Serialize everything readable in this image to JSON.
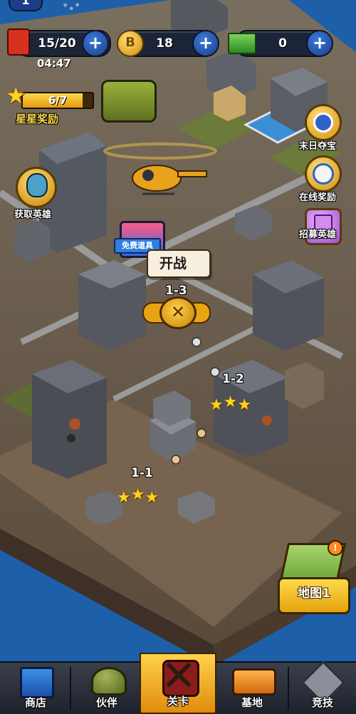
{
  "top": {
    "level": "1",
    "energy": "15/20",
    "energy_timer": "04:47",
    "coins": "18",
    "cash": "0",
    "plus_symbol": "+",
    "coin_symbol": "B"
  },
  "stars": {
    "progress_text": "6/7",
    "progress_fraction": 0.857,
    "reward_label": "星星奖励"
  },
  "left_buttons": {
    "get_hero": "获取英雄"
  },
  "right_buttons": {
    "doomsday_treasure": "末日夺宝",
    "online_rewards": "在线奖励",
    "recruit_heroes": "招募英雄"
  },
  "battle": {
    "free_props_tag": "免费道具",
    "start_label": "开战"
  },
  "stages": [
    {
      "label": "1-3",
      "stars": 0
    },
    {
      "label": "1-2",
      "stars": 3
    },
    {
      "label": "1-1",
      "stars": 3
    }
  ],
  "map_button": {
    "label": "地图1",
    "badge": "!"
  },
  "nav": {
    "shop": "商店",
    "partner": "伙伴",
    "stages": "关卡",
    "base": "基地",
    "arena": "竞技"
  },
  "colors": {
    "sea": "#1d5fa8",
    "ground": "#6b5a45",
    "gold": "#ffd21e",
    "nav_selected": "#f0a81c"
  }
}
